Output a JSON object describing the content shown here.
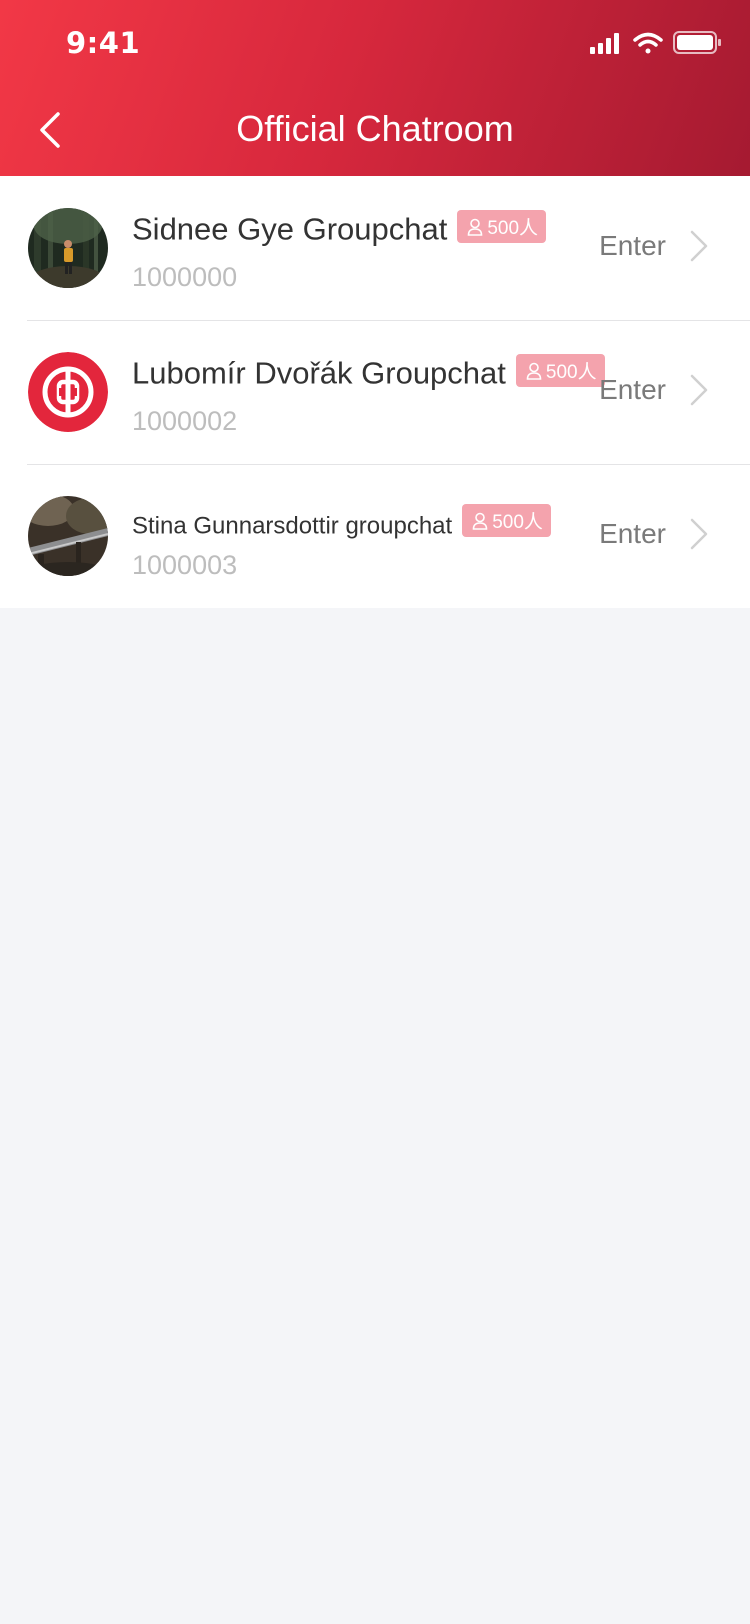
{
  "status_bar": {
    "time": "9:41",
    "icons": [
      "cellular-signal-icon",
      "wifi-icon",
      "battery-icon"
    ]
  },
  "nav": {
    "title": "Official Chatroom",
    "back_icon": "chevron-left-icon"
  },
  "colors": {
    "header_gradient": [
      "#f23846",
      "#a51a31"
    ],
    "badge_bg": "#f4a3ad",
    "page_bg": "#f4f5f8"
  },
  "rooms": [
    {
      "name": "Sidnee Gye Groupchat",
      "count": "500人",
      "id": "1000000",
      "enter_label": "Enter",
      "avatar": "forest-photo"
    },
    {
      "name": "Lubomír Dvořák Groupchat",
      "count": "500人",
      "id": "1000002",
      "enter_label": "Enter",
      "avatar": "bank-logo"
    },
    {
      "name": "Stina Gunnarsdottir groupchat",
      "count": "500人",
      "id": "1000003",
      "enter_label": "Enter",
      "avatar": "railway-photo"
    }
  ]
}
